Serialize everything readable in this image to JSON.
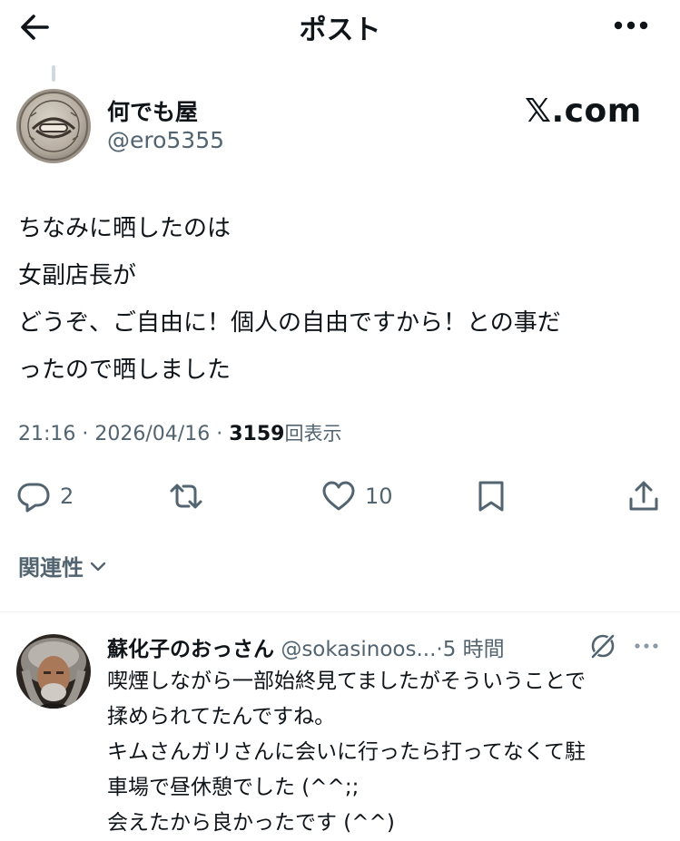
{
  "header": {
    "title": "ポスト",
    "back_icon": "arrow-left-icon",
    "more_icon": "more-horizontal-icon"
  },
  "post": {
    "author_name": "何でも屋",
    "author_handle": "@ero5355",
    "avatar": "seal-avatar",
    "badge": "𝕏.com",
    "lines": [
      "ちなみに晒したのは",
      "女副店長が",
      "どうぞ、ご自由に！個人の自由ですから！との事だ",
      "ったので晒しました"
    ],
    "time": "21:16",
    "date": "2026/04/16",
    "separator": "·",
    "views": "3159",
    "views_label": "回表示",
    "actions": {
      "reply_count": "2",
      "repost_count": "",
      "like_count": "10"
    }
  },
  "related": {
    "label": "関連性"
  },
  "reply": {
    "name": "蘇化子のおっさん",
    "handle": "@sokasinoos...",
    "separator": "·",
    "time": "5 時間",
    "lines": [
      "喫煙しながら一部始終見てましたがそういうことで",
      "揉められてたんですね。",
      "キムさんガリさんに会いに行ったら打ってなくて駐",
      "車場で昼休憩でした (^^;;",
      "会えたから良かったです (^^)"
    ]
  },
  "colors": {
    "text": "#0f1419",
    "secondary": "#536471",
    "divider": "#eff3f4"
  }
}
